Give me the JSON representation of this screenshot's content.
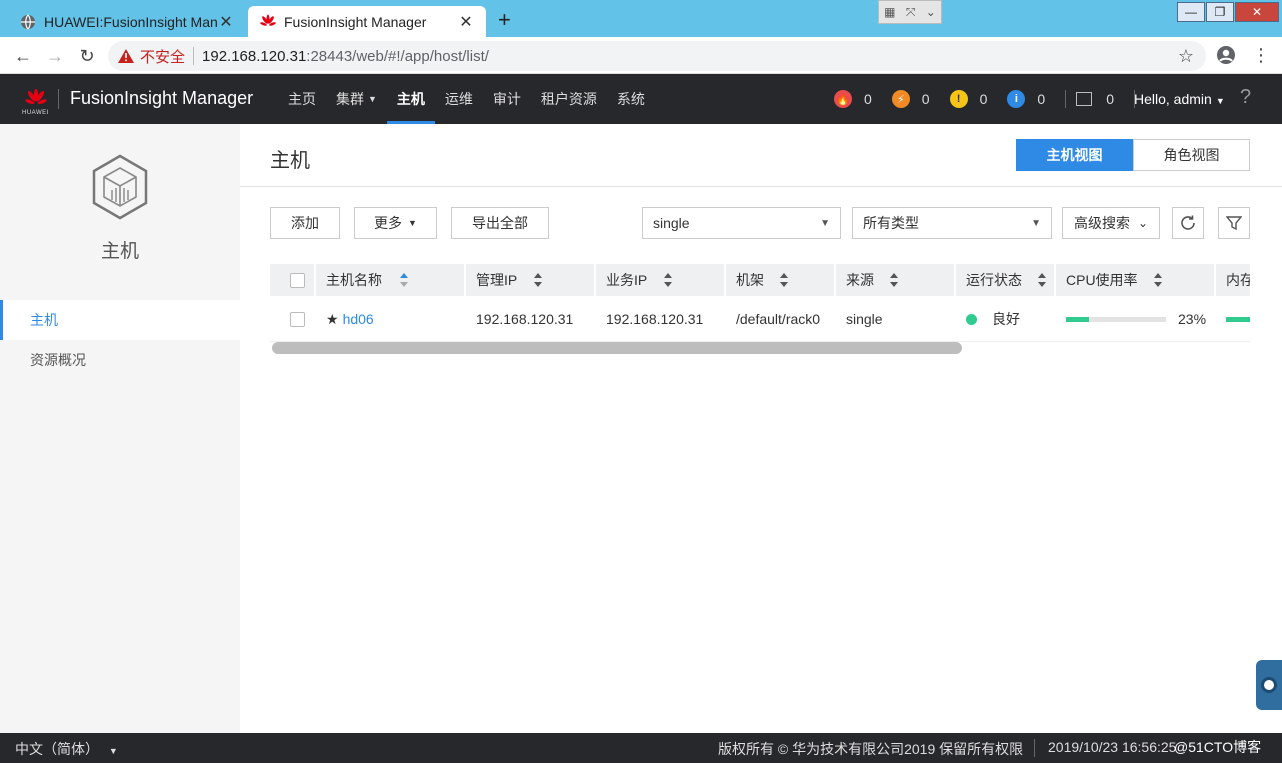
{
  "browser": {
    "tabs": [
      {
        "title": "HUAWEI:FusionInsight Manag",
        "active": false
      },
      {
        "title": "FusionInsight Manager",
        "active": true
      }
    ],
    "new_tab": "+",
    "address": {
      "security_label": "不安全",
      "host": "192.168.120.31",
      "path": ":28443/web/#!/app/host/list/"
    }
  },
  "header": {
    "logo_text": "HUAWEI",
    "brand": "FusionInsight Manager",
    "nav": [
      {
        "label": "主页",
        "active": false,
        "dropdown": false
      },
      {
        "label": "集群",
        "active": false,
        "dropdown": true
      },
      {
        "label": "主机",
        "active": true,
        "dropdown": false
      },
      {
        "label": "运维",
        "active": false,
        "dropdown": false
      },
      {
        "label": "审计",
        "active": false,
        "dropdown": false
      },
      {
        "label": "租户资源",
        "active": false,
        "dropdown": false
      },
      {
        "label": "系统",
        "active": false,
        "dropdown": false
      }
    ],
    "alarms": [
      {
        "icon": "critical-alarm-icon",
        "color": "#e84c4c",
        "count": "0"
      },
      {
        "icon": "major-alarm-icon",
        "color": "#f08a24",
        "count": "0"
      },
      {
        "icon": "minor-alarm-icon",
        "color": "#f5c518",
        "count": "0"
      },
      {
        "icon": "info-alarm-icon",
        "color": "#2f8ae6",
        "count": "0"
      }
    ],
    "task_count": "0",
    "user": "Hello, admin",
    "help": "?"
  },
  "sidebar": {
    "title": "主机",
    "items": [
      {
        "label": "主机",
        "active": true
      },
      {
        "label": "资源概况",
        "active": false
      }
    ]
  },
  "main": {
    "title": "主机",
    "views": {
      "host_view": "主机视图",
      "role_view": "角色视图"
    },
    "toolbar": {
      "add": "添加",
      "more": "更多",
      "export": "导出全部",
      "cluster_select": "single",
      "type_select": "所有类型",
      "advanced_search": "高级搜索"
    },
    "table": {
      "columns": [
        "主机名称",
        "管理IP",
        "业务IP",
        "机架",
        "来源",
        "运行状态",
        "CPU使用率",
        "内存"
      ],
      "rows": [
        {
          "name": "hd06",
          "mgmt_ip": "192.168.120.31",
          "biz_ip": "192.168.120.31",
          "rack": "/default/rack0",
          "source": "single",
          "status": "良好",
          "cpu_usage": "23%",
          "cpu_fraction": 0.23
        }
      ]
    }
  },
  "footer": {
    "language": "中文（简体）",
    "copyright": "版权所有 © 华为技术有限公司2019 保留所有权限",
    "datetime": "2019/10/23 16:56:25",
    "watermark": "@51CTO博客"
  },
  "colors": {
    "accent": "#2f8ae6",
    "header_bg": "#26282c",
    "status_good": "#2fcb8f"
  }
}
